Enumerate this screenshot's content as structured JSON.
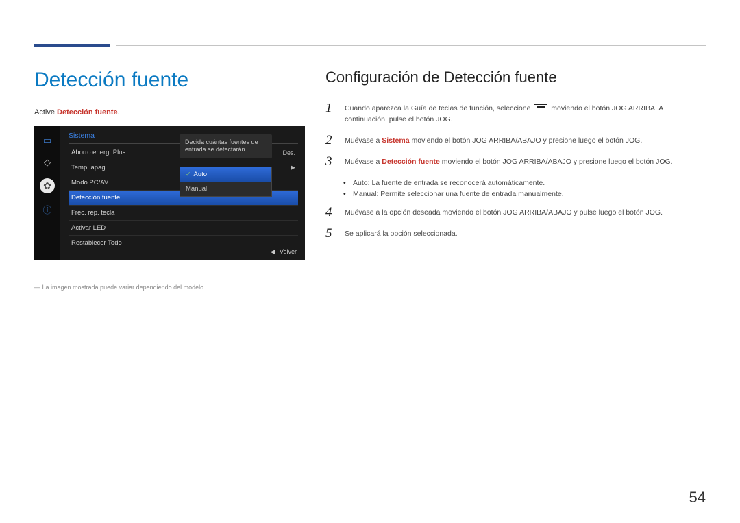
{
  "page_number": "54",
  "left": {
    "heading": "Detección fuente",
    "intro_prefix": "Active ",
    "intro_highlight": "Detección fuente",
    "intro_suffix": ".",
    "footnote": "La imagen mostrada puede variar dependiendo del modelo."
  },
  "osd": {
    "title": "Sistema",
    "rows": [
      {
        "label": "Ahorro energ. Plus",
        "value": "Des."
      },
      {
        "label": "Temp. apag.",
        "value": "▶"
      },
      {
        "label": "Modo PC/AV",
        "value": ""
      },
      {
        "label": "Detección fuente",
        "value": ""
      },
      {
        "label": "Frec. rep. tecla",
        "value": ""
      },
      {
        "label": "Activar LED",
        "value": ""
      },
      {
        "label": "Restablecer Todo",
        "value": ""
      }
    ],
    "note": "Decida cuántas fuentes de entrada se detectarán.",
    "options": [
      "Auto",
      "Manual"
    ],
    "footer_symbol": "◀",
    "footer_label": "Volver"
  },
  "right": {
    "heading": "Configuración de Detección fuente",
    "steps": {
      "s1a": "Cuando aparezca la Guía de teclas de función, seleccione ",
      "s1b": " moviendo el botón JOG ARRIBA. A continuación, pulse el botón JOG.",
      "s2a": "Muévase a ",
      "s2hl": "Sistema",
      "s2b": " moviendo el botón JOG ARRIBA/ABAJO y presione luego el botón JOG.",
      "s3a": "Muévase a ",
      "s3hl": "Detección fuente",
      "s3b": " moviendo el botón JOG ARRIBA/ABAJO y presione luego el botón JOG.",
      "s4": "Muévase a la opción deseada moviendo el botón JOG ARRIBA/ABAJO y pulse luego el botón JOG.",
      "s5": "Se aplicará la opción seleccionada."
    },
    "bullets": {
      "b1_label": "Auto",
      "b1_text": ": La fuente de entrada se reconocerá automáticamente.",
      "b2_label": "Manual",
      "b2_text": ": Permite seleccionar una fuente de entrada manualmente."
    },
    "nums": {
      "n1": "1",
      "n2": "2",
      "n3": "3",
      "n4": "4",
      "n5": "5"
    }
  }
}
